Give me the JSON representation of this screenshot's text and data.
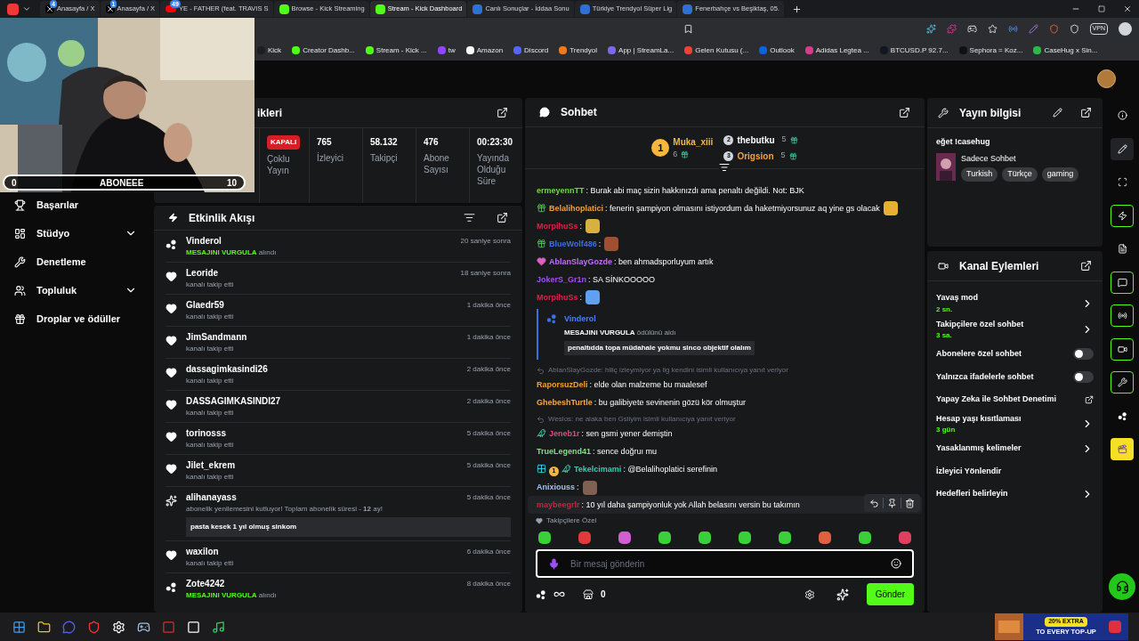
{
  "browser": {
    "tabs": [
      {
        "kind": "x",
        "title": "Anasayfa / X",
        "badge": "4",
        "selected": false
      },
      {
        "kind": "x",
        "title": "Anasayfa / X",
        "badge": "1",
        "selected": false
      },
      {
        "kind": "youtube",
        "title": "YE - FATHER (feat. TRAVIS S",
        "badge": "49",
        "selected": false
      },
      {
        "kind": "kick",
        "title": "Browse - Kick Streaming",
        "selected": false
      },
      {
        "kind": "kick",
        "title": "Stream - Kick Dashboard",
        "selected": true
      },
      {
        "kind": "m",
        "title": "Canlı Sonuçlar - İddaa Sonu",
        "selected": false
      },
      {
        "kind": "m",
        "title": "Türkiye Trendyol Süper Lig",
        "selected": false
      },
      {
        "kind": "m",
        "title": "Fenerbahçe vs Beşiktaş, 05.",
        "selected": false
      }
    ],
    "vpn": "VPN",
    "bookmarks": [
      {
        "label": "Kick",
        "color": "#1e1e1e"
      },
      {
        "label": "Creator Dashb...",
        "color": "#53fc18"
      },
      {
        "label": "Stream - Kick ...",
        "color": "#53fc18"
      },
      {
        "label": "tw",
        "color": "#9146ff"
      },
      {
        "label": "Amazon",
        "color": "#ffffff"
      },
      {
        "label": "Discord",
        "color": "#5865f2"
      },
      {
        "label": "Trendyol",
        "color": "#f27a1a"
      },
      {
        "label": "App | StreamLa...",
        "color": "#7b68ee"
      },
      {
        "label": "Gelen Kutusu (...",
        "color": "#ea4335"
      },
      {
        "label": "Outlook",
        "color": "#0a64d8"
      },
      {
        "label": "Adidas Legtea ...",
        "color": "#d63c8c"
      },
      {
        "label": "BTCUSD.P 92.7...",
        "color": "#131722"
      },
      {
        "label": "Sephora = Koz...",
        "color": "#111111"
      },
      {
        "label": "CaseHug x Sin...",
        "color": "#2eb84a"
      }
    ]
  },
  "webcam": {
    "goal": {
      "start": "0",
      "label": "ABONEEE",
      "end": "10",
      "level": 0
    }
  },
  "sidebar": {
    "items": [
      {
        "label": "Başarılar",
        "expandable": false
      },
      {
        "label": "Stüdyo",
        "expandable": true
      },
      {
        "label": "Denetleme",
        "expandable": false
      },
      {
        "label": "Topluluk",
        "expandable": true
      },
      {
        "label": "Droplar ve ödüller",
        "expandable": false
      }
    ]
  },
  "stats": {
    "title": "ikleri",
    "status": "KAPALI",
    "status_label": "Çoklu Yayın",
    "cells": [
      {
        "value": "765",
        "label": "İzleyici"
      },
      {
        "value": "58.132",
        "label": "Takipçi"
      },
      {
        "value": "476",
        "label": "Abone Sayısı"
      },
      {
        "value": "00:23:30",
        "label": "Yayında Olduğu Süre"
      }
    ]
  },
  "activity": {
    "title": "Etkinlik Akışı",
    "items": [
      {
        "kind": "reward",
        "name": "Vinderol",
        "reward": "MESAJINI VURGULA",
        "action": "alındı",
        "time": "20 saniye sonra"
      },
      {
        "kind": "follow",
        "name": "Leoride",
        "action": "kanalı takip etti",
        "time": "18 saniye sonra"
      },
      {
        "kind": "follow",
        "name": "Glaedr59",
        "action": "kanalı takip etti",
        "time": "1 dakika önce"
      },
      {
        "kind": "follow",
        "name": "JimSandmann",
        "action": "kanalı takip etti",
        "time": "1 dakika önce"
      },
      {
        "kind": "follow",
        "name": "dassagimkasindi26",
        "action": "kanalı takip etti",
        "time": "2 dakika önce"
      },
      {
        "kind": "follow",
        "name": "DASSAGIMKASINDI27",
        "action": "kanalı takip etti",
        "time": "2 dakika önce"
      },
      {
        "kind": "follow",
        "name": "torinosss",
        "action": "kanalı takip etti",
        "time": "5 dakika önce"
      },
      {
        "kind": "follow",
        "name": "Jilet_ekrem",
        "action": "kanalı takip etti",
        "time": "5 dakika önce"
      },
      {
        "kind": "resub",
        "name": "alihanayass",
        "action": "abonelik yenilemesini kutluyor! Toplam abonelik süresi - **12** ay!",
        "message": "pasta kesek 1 yıl olmuş sinkom",
        "time": "5 dakika önce"
      },
      {
        "kind": "follow",
        "name": "waxilon",
        "action": "kanalı takip etti",
        "time": "6 dakika önce"
      },
      {
        "kind": "reward",
        "name": "Zote4242",
        "reward": "MESAJINI VURGULA",
        "action": "alındı",
        "time": "8 dakika önce"
      }
    ]
  },
  "chat": {
    "title": "Sohbet",
    "leaders": [
      {
        "rank": "1",
        "name": "Muka_xiii",
        "count": "6",
        "color": "#f5b83d"
      },
      {
        "rank": "2",
        "name": "thebutku",
        "count": "5",
        "color": "#ffffff"
      },
      {
        "rank": "3",
        "name": "Origsion",
        "count": "5",
        "color": "#f5a03d"
      }
    ],
    "messages": [
      {
        "kind": "text",
        "user": "ermeyennTT",
        "color": "#72d44a",
        "text": ": Burak abi maç sizin hakkınızdı ama penaltı değildi. Not: BJK"
      },
      {
        "kind": "text",
        "badges": [
          {
            "kind": "gift"
          }
        ],
        "user": "Belalihoplatici",
        "color": "#f0a040",
        "text": ": fenerin şampiyon olmasını istiyordum da haketmiyorsunuz aq yine gs olacak",
        "emote": {
          "color": "#e8b030"
        }
      },
      {
        "kind": "text",
        "user": "MorpihuSs",
        "color": "#e0204a",
        "text": ":",
        "emote": {
          "color": "#d8b040"
        }
      },
      {
        "kind": "text",
        "badges": [
          {
            "kind": "gift"
          }
        ],
        "user": "BlueWolf486",
        "color": "#3a70e0",
        "text": ":",
        "emote": {
          "color": "#a05030"
        }
      },
      {
        "kind": "text",
        "badges": [
          {
            "kind": "heart"
          }
        ],
        "user": "AblanSlayGozde",
        "color": "#c070f0",
        "text": ": ben ahmadsporluyum artık"
      },
      {
        "kind": "text",
        "user": "JokerS_Gr1n",
        "color": "#a050f0",
        "text": ": SA SİNKOOOOO"
      },
      {
        "kind": "text",
        "user": "MorpihuSs",
        "color": "#e0204a",
        "text": ":",
        "emote": {
          "color": "#60a0f0"
        }
      },
      {
        "kind": "highlight",
        "user": "Vinderol",
        "color": "#4a80f0",
        "reward": "MESAJINI VURGULA",
        "action": "ödülünü aldı",
        "text": "penaltıdda topa müdahale yokmu sinco objektif olalım"
      },
      {
        "kind": "reply",
        "text": "AblanSlayGozde: hiliç izleymiyor ya lig kendini isimli kullanıcıya yanıt veriyor"
      },
      {
        "kind": "text",
        "user": "RaporsuzDeli",
        "color": "#f0a030",
        "text": ": elde olan malzeme bu maalesef"
      },
      {
        "kind": "text",
        "user": "GhebeshTurtle",
        "color": "#f0a848",
        "text": ": bu galibiyete sevinenin gözü kör olmuştur"
      },
      {
        "kind": "reply",
        "text": "Weslos: ne alaka ben Gsliyim isimli kullanıcıya yanıt veriyor"
      },
      {
        "kind": "text",
        "badges": [
          {
            "kind": "bird"
          }
        ],
        "user": "Jeneb1r",
        "color": "#e04a80",
        "text": ": sen gsmi yener demiştin"
      },
      {
        "kind": "text",
        "user": "TrueLegend41",
        "color": "#80e080",
        "text": ": sence doğruı mu"
      },
      {
        "kind": "text",
        "badges": [
          {
            "kind": "grid"
          },
          {
            "kind": "rank",
            "text": "1"
          },
          {
            "kind": "bird"
          }
        ],
        "user": "Tekelcimami",
        "color": "#30d0b0",
        "text": ": @Belalihoplatici serefinin"
      },
      {
        "kind": "text",
        "user": "Anixiouss",
        "color": "#a0c0f0",
        "text": ":",
        "emote": {
          "color": "#806050"
        }
      },
      {
        "kind": "text",
        "user": "maybeegrlr",
        "color": "#d02040",
        "text": ": 10 yıl daha şampiyonluk yok Allah belasını versin bu takımın",
        "hovered": true
      }
    ],
    "followers_only": "Takipçilere Özel",
    "emotes": [
      {
        "color": "#3ad03a"
      },
      {
        "color": "#e03a3a"
      },
      {
        "color": "#d060d0"
      },
      {
        "color": "#3ad03a"
      },
      {
        "color": "#3ad03a"
      },
      {
        "color": "#3ad03a"
      },
      {
        "color": "#3ad03a"
      },
      {
        "color": "#e06040"
      },
      {
        "color": "#3ad03a"
      },
      {
        "color": "#e04060"
      }
    ],
    "placeholder": "Bir mesaj gönderin",
    "points": "0",
    "send": "Gönder"
  },
  "stream_info": {
    "title": "Yayın bilgisi",
    "stream_title": "eğet !casehug",
    "category": "Sadece Sohbet",
    "tags": [
      "Turkish",
      "Türkçe",
      "gaming"
    ]
  },
  "channel_actions": {
    "title": "Kanal Eylemleri",
    "items": [
      {
        "kind": "nav",
        "label": "Yavaş mod",
        "value": "2 sn."
      },
      {
        "kind": "nav",
        "label": "Takipçilere özel sohbet",
        "value": "3 sa."
      },
      {
        "kind": "toggle",
        "label": "Abonelere özel sohbet",
        "on": false
      },
      {
        "kind": "toggle",
        "label": "Yalnızca ifadelerle sohbet",
        "on": false
      },
      {
        "kind": "external",
        "label": "Yapay Zeka ile Sohbet Denetimi"
      },
      {
        "kind": "nav",
        "label": "Hesap yaşı kısıtlaması",
        "value": "3 gün"
      },
      {
        "kind": "nav",
        "label": "Yasaklanmış kelimeler"
      },
      {
        "kind": "plain",
        "label": "İzleyici Yönlendir"
      },
      {
        "kind": "nav",
        "label": "Hedefleri belirleyin"
      }
    ]
  },
  "rail": [
    {
      "active": false
    },
    {
      "active": false
    },
    {
      "active": false
    },
    {
      "active": true
    },
    {
      "active": false
    },
    {
      "active": true
    },
    {
      "active": true
    },
    {
      "active": true
    },
    {
      "active": true
    },
    {
      "active": false
    },
    {
      "active": false
    }
  ],
  "taskbar": {
    "ad": {
      "headline": "20% EXTRA",
      "subline": "TO EVERY TOP-UP"
    }
  }
}
